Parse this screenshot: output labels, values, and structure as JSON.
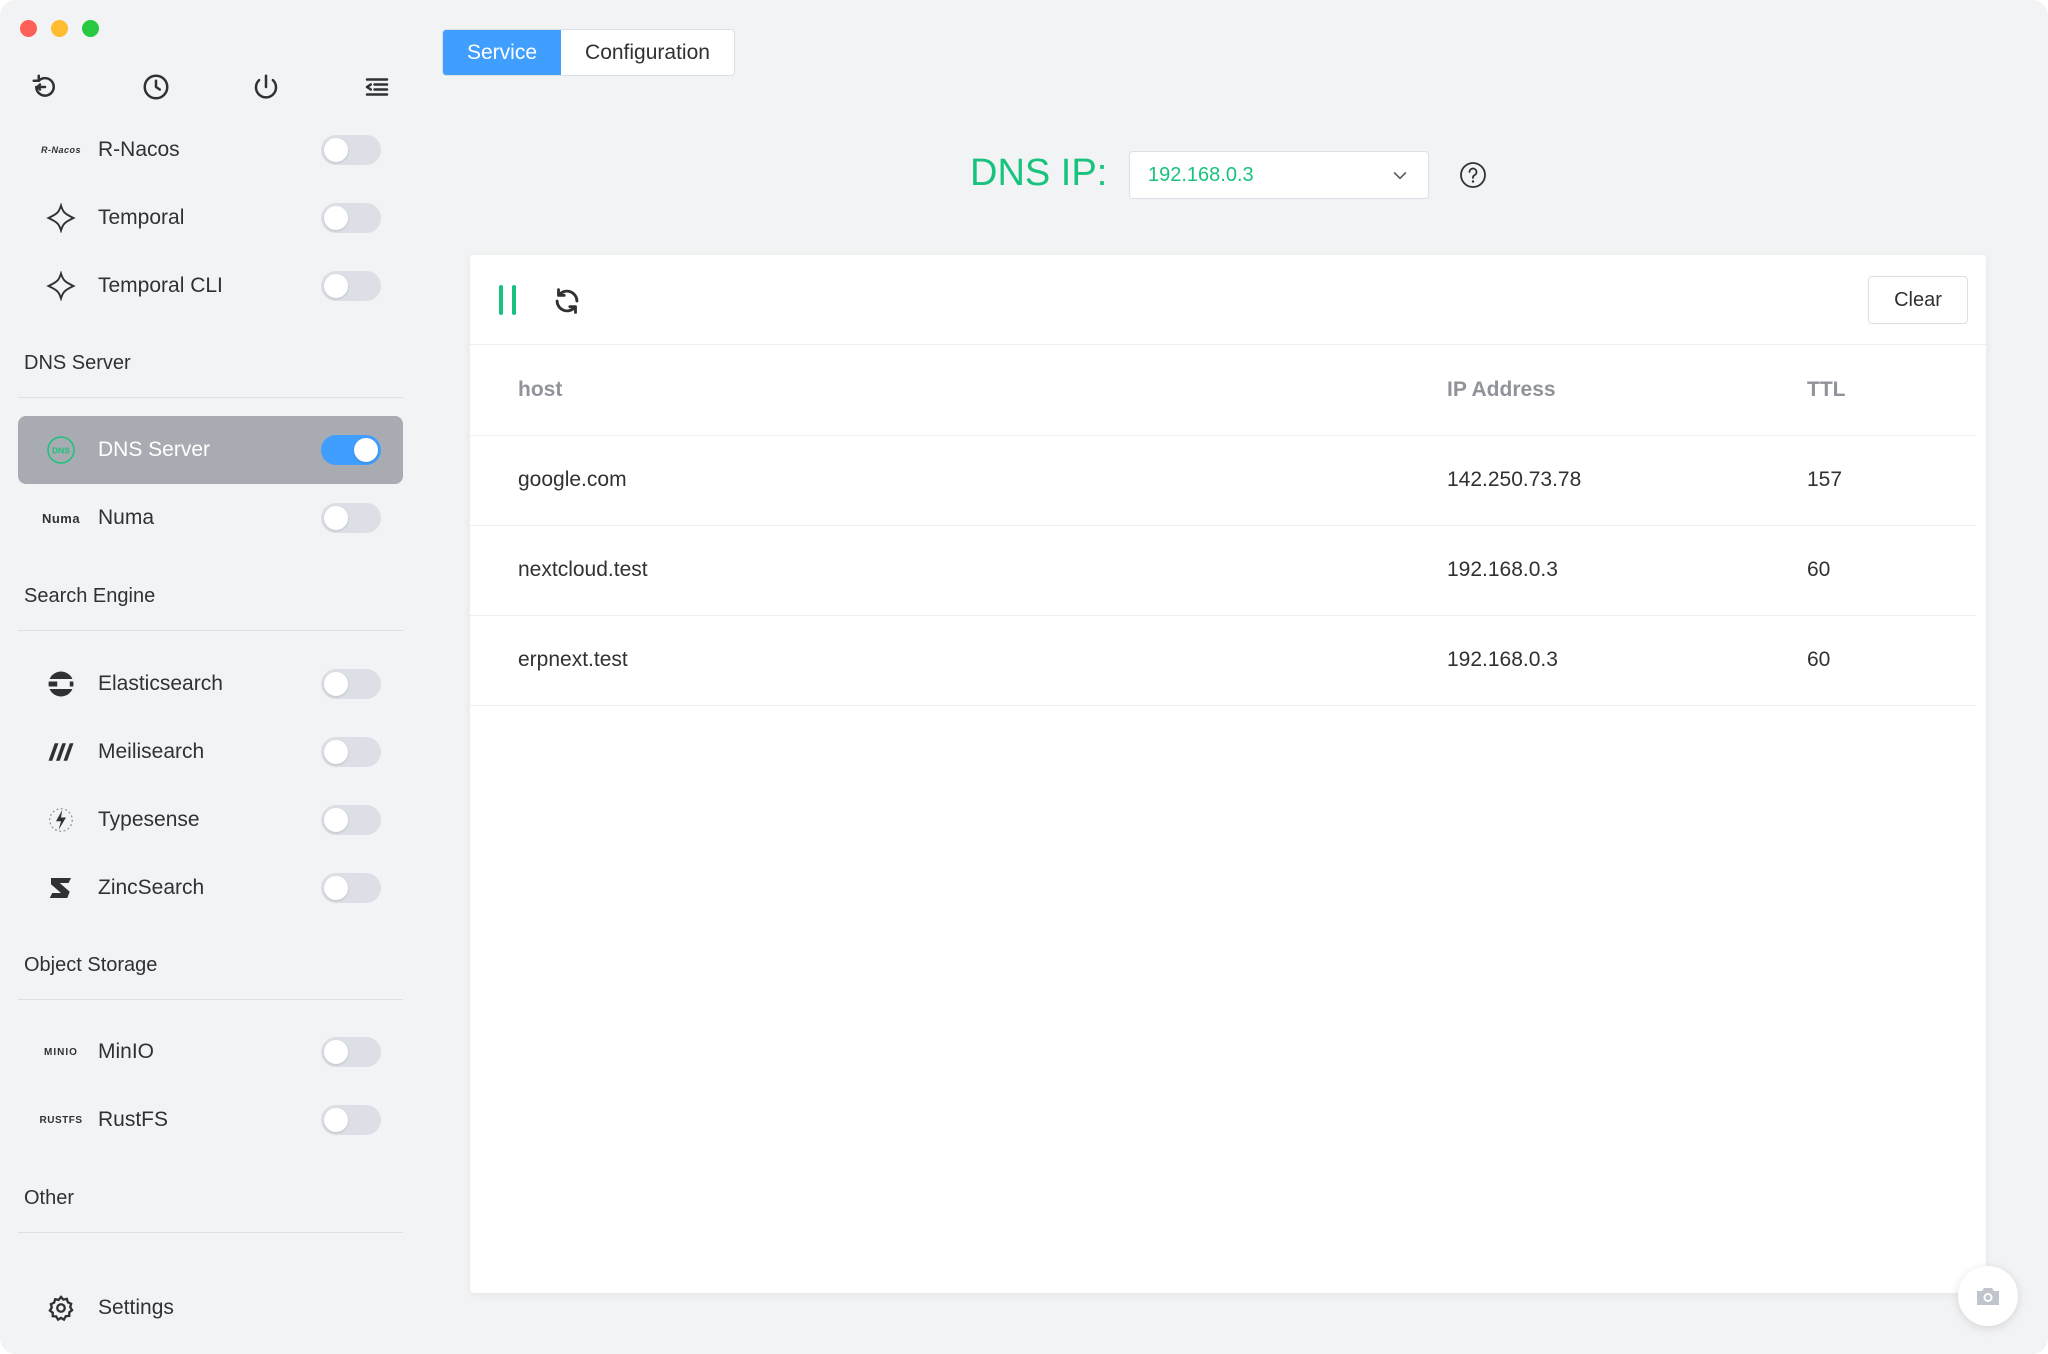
{
  "sidebar": {
    "items_top": [
      {
        "name": "R-Nacos",
        "logo_text": "R-Nacos",
        "enabled": false
      },
      {
        "name": "Temporal",
        "enabled": false
      },
      {
        "name": "Temporal CLI",
        "enabled": false
      }
    ],
    "sections": {
      "dns": "DNS Server",
      "search": "Search Engine",
      "object": "Object Storage",
      "other": "Other"
    },
    "dns_items": [
      {
        "name": "DNS Server",
        "logo_text": "DNS",
        "enabled": true,
        "active": true
      },
      {
        "name": "Numa",
        "logo_text": "Numa",
        "enabled": false
      }
    ],
    "search_items": [
      {
        "name": "Elasticsearch",
        "enabled": false
      },
      {
        "name": "Meilisearch",
        "enabled": false
      },
      {
        "name": "Typesense",
        "enabled": false
      },
      {
        "name": "ZincSearch",
        "enabled": false
      }
    ],
    "storage_items": [
      {
        "name": "MinIO",
        "logo_text": "MINIO",
        "enabled": false
      },
      {
        "name": "RustFS",
        "logo_text": "RUSTFS",
        "enabled": false
      }
    ],
    "settings_label": "Settings"
  },
  "tabs": [
    "Service",
    "Configuration"
  ],
  "dns": {
    "label": "DNS IP:",
    "selected_ip": "192.168.0.3"
  },
  "toolbar": {
    "clear_label": "Clear"
  },
  "table": {
    "headers": [
      "host",
      "IP Address",
      "TTL"
    ],
    "rows": [
      [
        "google.com",
        "142.250.73.78",
        "157"
      ],
      [
        "nextcloud.test",
        "192.168.0.3",
        "60"
      ],
      [
        "erpnext.test",
        "192.168.0.3",
        "60"
      ]
    ]
  },
  "colors": {
    "accent": "#409eff",
    "green": "#19c37d",
    "active_item": "#a8abb2"
  }
}
